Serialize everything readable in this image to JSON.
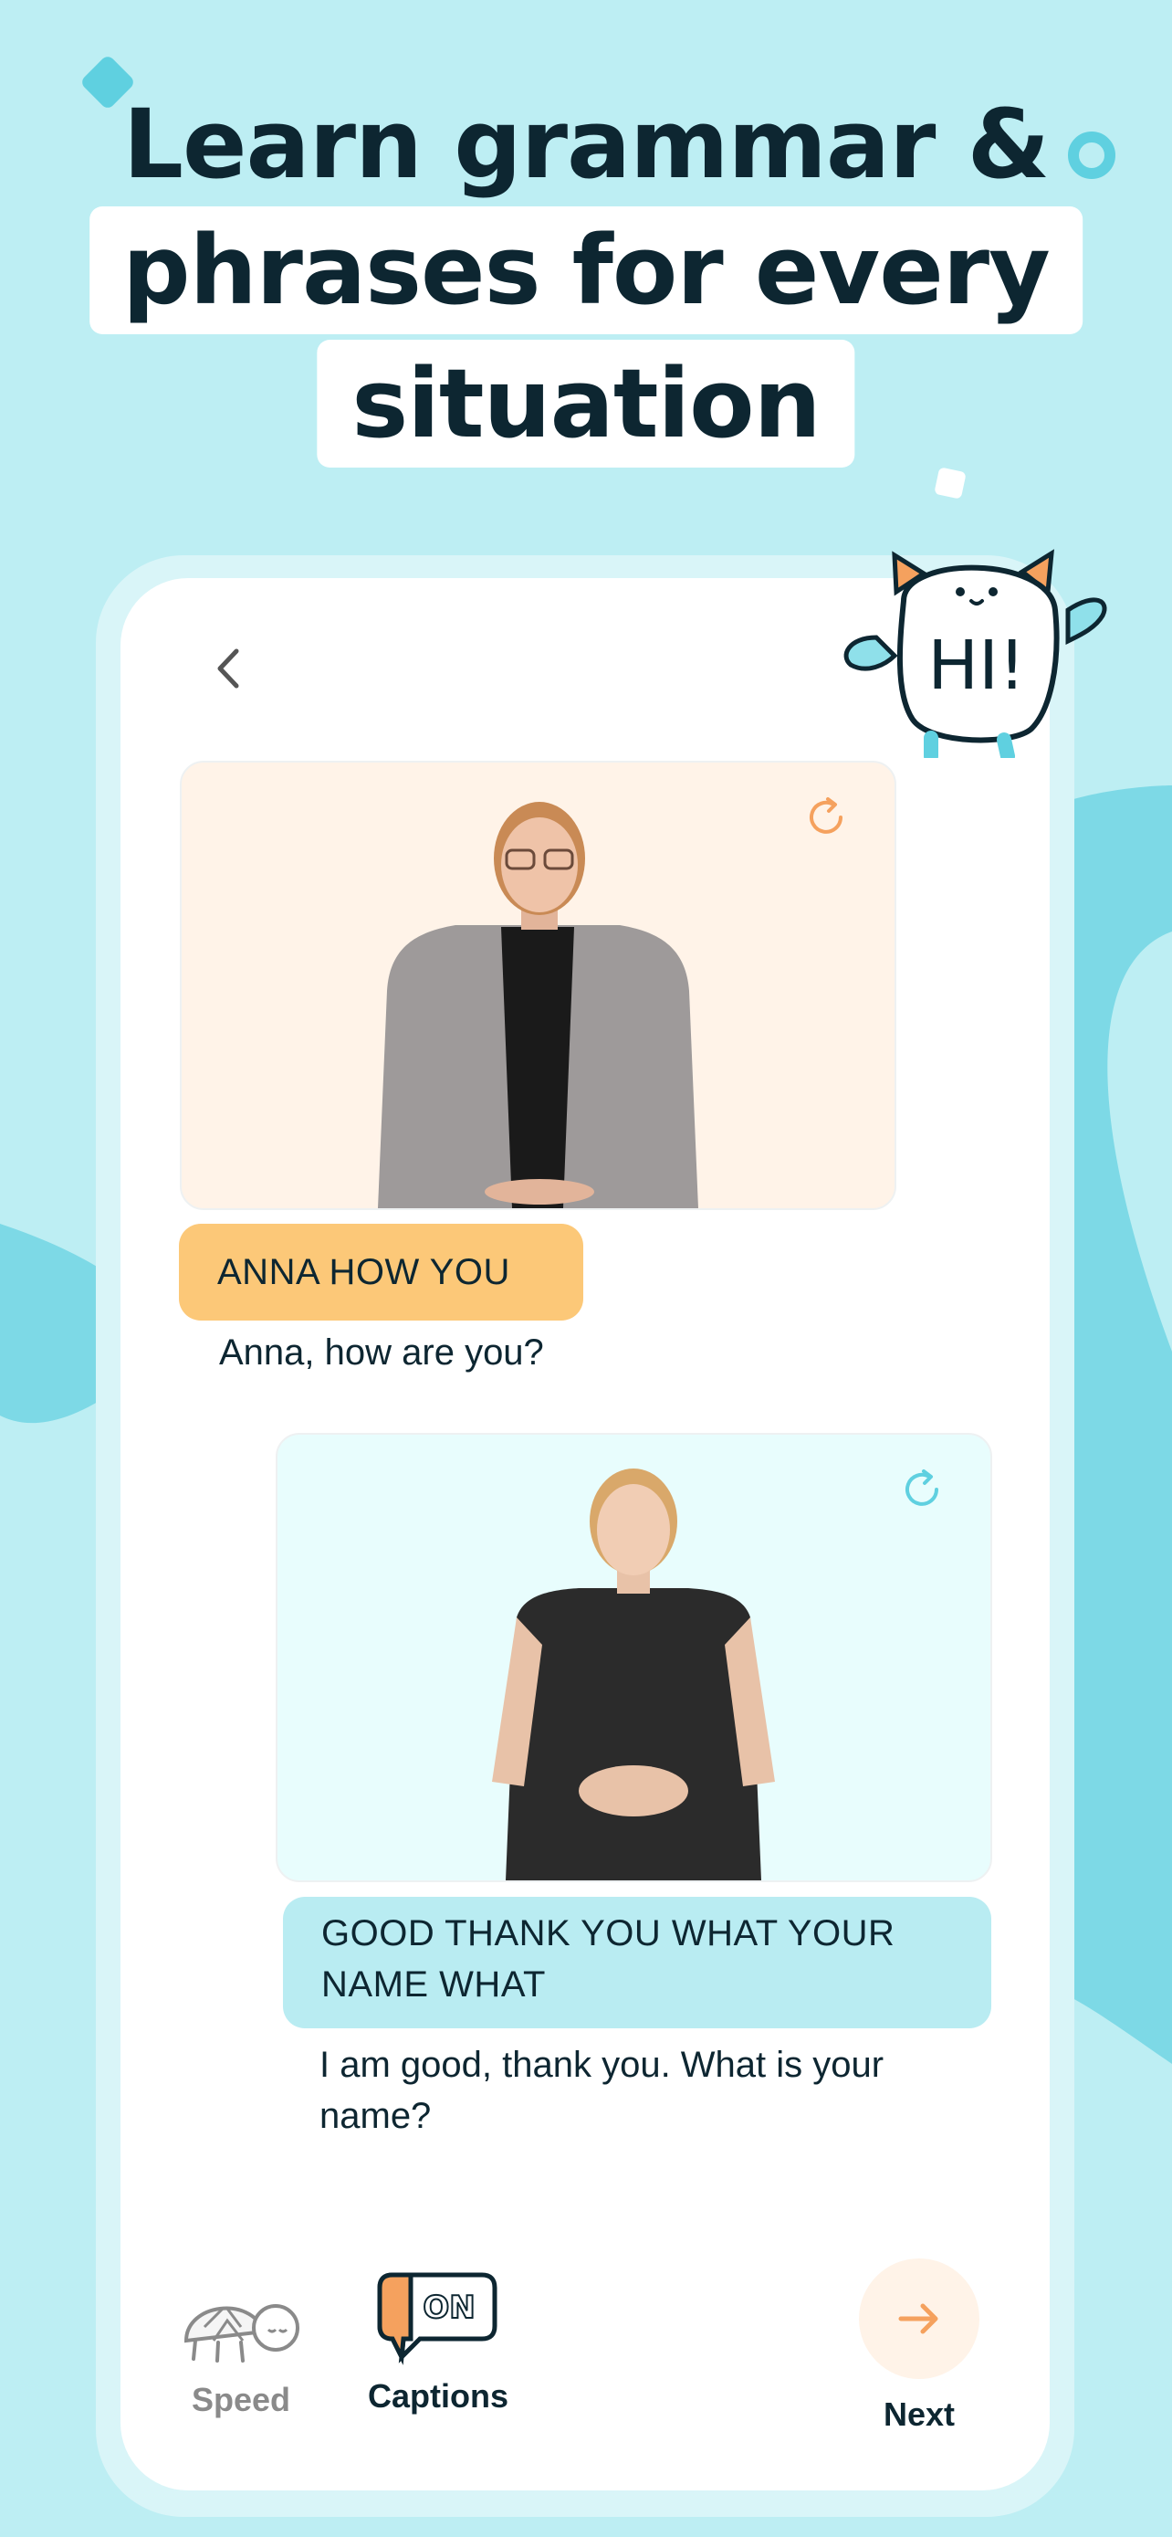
{
  "headline": {
    "line1": "Learn grammar &",
    "line2": "phrases for every",
    "line3": "situation"
  },
  "mascot": {
    "text": "HI!",
    "icon": "mascot-ghost-icon"
  },
  "screen": {
    "back_icon": "chevron-left-icon",
    "messages": [
      {
        "gloss": "ANNA HOW YOU",
        "translation": "Anna, how are you?",
        "replay_icon": "replay-icon",
        "accent": "#fcc878"
      },
      {
        "gloss": "GOOD THANK YOU WHAT YOUR NAME WHAT",
        "translation": "I am good, thank you. What is your name?",
        "replay_icon": "replay-icon",
        "accent": "#b9ecf2"
      }
    ],
    "controls": {
      "speed": {
        "label": "Speed",
        "icon": "turtle-icon"
      },
      "captions": {
        "label": "Captions",
        "badge": "ON",
        "icon": "captions-bubble-icon"
      },
      "next": {
        "label": "Next",
        "icon": "arrow-right-icon"
      }
    }
  },
  "colors": {
    "background": "#bdeef3",
    "accent_orange": "#f5a15e",
    "accent_teal": "#5fd0e0",
    "text_dark": "#0d2631"
  }
}
